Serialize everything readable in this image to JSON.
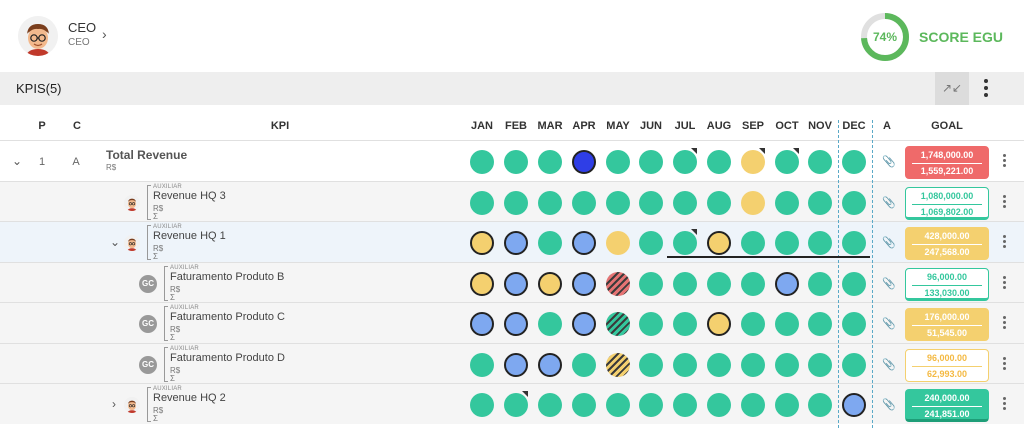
{
  "user": {
    "name": "CEO",
    "role": "CEO"
  },
  "score": {
    "percent": "74%",
    "value": 0.74,
    "label": "SCORE EGU",
    "color": "#5cb85c"
  },
  "toolbar": {
    "title": "KPIS(5)"
  },
  "columns": {
    "p": "P",
    "c": "C",
    "kpi": "KPI",
    "attach": "A",
    "goal": "GOAL"
  },
  "months": [
    "JAN",
    "FEB",
    "MAR",
    "APR",
    "MAY",
    "JUN",
    "JUL",
    "AUG",
    "SEP",
    "OCT",
    "NOV",
    "DEC"
  ],
  "colors": {
    "green": "#34c79d",
    "yellow": "#f4d06f",
    "blue": "#7ea8f0",
    "red": "#ef6a6a"
  },
  "rows": [
    {
      "p": "1",
      "c": "A",
      "title": "Total Revenue",
      "unit": "R$",
      "aux": "",
      "sigma": "",
      "dots": [
        "green",
        "green",
        "green",
        "bright-blue-outline",
        "green",
        "green",
        "green-flag",
        "green",
        "yellow-flag",
        "green-flag",
        "green",
        "green"
      ],
      "goal": {
        "v1": "1,748,000.00",
        "v2": "1,559,221.00",
        "style": "red"
      }
    },
    {
      "p": "",
      "c": "",
      "title": "Revenue HQ 3",
      "unit": "R$",
      "aux": "AUXILIAR",
      "sigma": "Σ",
      "dots": [
        "green",
        "green",
        "green",
        "green",
        "green",
        "green",
        "green",
        "green",
        "yellow",
        "green",
        "green",
        "green"
      ],
      "goal": {
        "v1": "1,080,000.00",
        "v2": "1,069,802.00",
        "style": "green-out"
      }
    },
    {
      "p": "",
      "c": "",
      "title": "Revenue HQ 1",
      "unit": "R$",
      "aux": "AUXILIAR",
      "sigma": "Σ",
      "dots": [
        "yellow-outline",
        "blue-outline",
        "green",
        "blue-outline",
        "yellow",
        "green",
        "green-flag",
        "yellow-outline",
        "green",
        "green",
        "green",
        "green"
      ],
      "goal": {
        "v1": "428,000.00",
        "v2": "247,568.00",
        "style": "yellow"
      }
    },
    {
      "p": "",
      "c": "",
      "title": "Faturamento Produto B",
      "unit": "R$",
      "aux": "AUXILIAR",
      "sigma": "Σ",
      "badge": "GC",
      "dots": [
        "yellow-outline",
        "blue-outline",
        "yellow-outline",
        "blue-outline",
        "hatch-red",
        "green",
        "green",
        "green",
        "green",
        "blue-outline",
        "green",
        "green"
      ],
      "goal": {
        "v1": "96,000.00",
        "v2": "133,030.00",
        "style": "green-out"
      }
    },
    {
      "p": "",
      "c": "",
      "title": "Faturamento Produto C",
      "unit": "R$",
      "aux": "AUXILIAR",
      "sigma": "Σ",
      "badge": "GC",
      "dots": [
        "blue-outline",
        "blue-outline",
        "green",
        "blue-outline",
        "hatch-green",
        "green",
        "green",
        "yellow-outline",
        "green",
        "green",
        "green",
        "green"
      ],
      "goal": {
        "v1": "176,000.00",
        "v2": "51,545.00",
        "style": "yellow"
      }
    },
    {
      "p": "",
      "c": "",
      "title": "Faturamento Produto D",
      "unit": "R$",
      "aux": "AUXILIAR",
      "sigma": "Σ",
      "badge": "GC",
      "dots": [
        "green",
        "blue-outline",
        "blue-outline",
        "green",
        "hatch-yellow",
        "green",
        "green",
        "green",
        "green",
        "green",
        "green",
        "green"
      ],
      "goal": {
        "v1": "96,000.00",
        "v2": "62,993.00",
        "style": "yellow-out"
      }
    },
    {
      "p": "",
      "c": "",
      "title": "Revenue HQ 2",
      "unit": "R$",
      "aux": "AUXILIAR",
      "sigma": "Σ",
      "dots": [
        "green",
        "green-flag",
        "green",
        "green",
        "green",
        "green",
        "green",
        "green",
        "green",
        "green",
        "green",
        "blue-outline"
      ],
      "goal": {
        "v1": "240,000.00",
        "v2": "241,851.00",
        "style": "green-solid"
      }
    }
  ],
  "icons": {
    "expand": "chevron-down-icon",
    "collapse": "chevron-right-icon",
    "attach": "paperclip-icon",
    "more": "more-vertical-icon",
    "minimize": "collapse-arrows-icon"
  }
}
